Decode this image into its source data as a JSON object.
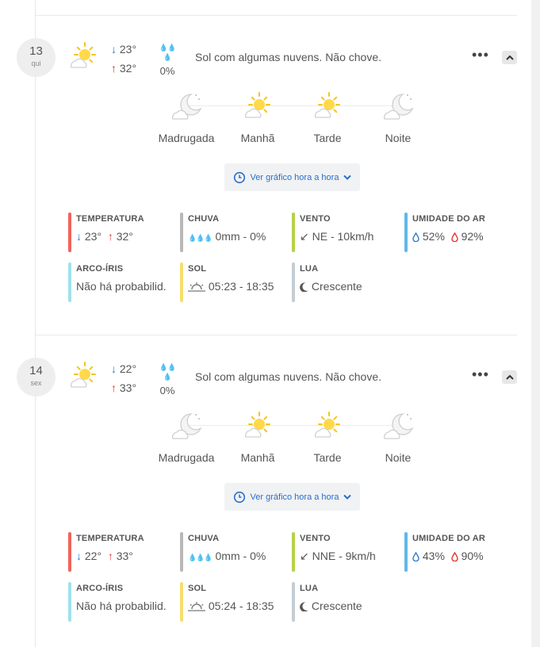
{
  "days": [
    {
      "day_number": "13",
      "weekday": "qui",
      "temp_min": "23°",
      "temp_max": "32°",
      "rain_prob": "0%",
      "description": "Sol com algumas nuvens. Não chove.",
      "periods": [
        {
          "label": "Madrugada",
          "icon": "moon-cloud-icon"
        },
        {
          "label": "Manhã",
          "icon": "sun-cloud-icon"
        },
        {
          "label": "Tarde",
          "icon": "sun-cloud-icon"
        },
        {
          "label": "Noite",
          "icon": "moon-cloud-icon"
        }
      ],
      "hourly_button": "Ver gráfico hora a hora",
      "stats": {
        "temperatura": {
          "title": "TEMPERATURA",
          "min": "23°",
          "max": "32°"
        },
        "chuva": {
          "title": "CHUVA",
          "value": "0mm - 0%"
        },
        "vento": {
          "title": "VENTO",
          "value": "NE - 10km/h"
        },
        "umidade": {
          "title": "UMIDADE DO AR",
          "min": "52%",
          "max": "92%"
        },
        "arco_iris": {
          "title": "ARCO-ÍRIS",
          "value": "Não há probabilid."
        },
        "sol": {
          "title": "SOL",
          "value": "05:23 - 18:35"
        },
        "lua": {
          "title": "LUA",
          "value": "Crescente"
        }
      }
    },
    {
      "day_number": "14",
      "weekday": "sex",
      "temp_min": "22°",
      "temp_max": "33°",
      "rain_prob": "0%",
      "description": "Sol com algumas nuvens. Não chove.",
      "periods": [
        {
          "label": "Madrugada",
          "icon": "moon-cloud-icon"
        },
        {
          "label": "Manhã",
          "icon": "sun-cloud-icon"
        },
        {
          "label": "Tarde",
          "icon": "sun-cloud-icon"
        },
        {
          "label": "Noite",
          "icon": "moon-cloud-icon"
        }
      ],
      "hourly_button": "Ver gráfico hora a hora",
      "stats": {
        "temperatura": {
          "title": "TEMPERATURA",
          "min": "22°",
          "max": "33°"
        },
        "chuva": {
          "title": "CHUVA",
          "value": "0mm - 0%"
        },
        "vento": {
          "title": "VENTO",
          "value": "NNE - 9km/h"
        },
        "umidade": {
          "title": "UMIDADE DO AR",
          "min": "43%",
          "max": "90%"
        },
        "arco_iris": {
          "title": "ARCO-ÍRIS",
          "value": "Não há probabilid."
        },
        "sol": {
          "title": "SOL",
          "value": "05:24 - 18:35"
        },
        "lua": {
          "title": "LUA",
          "value": "Crescente"
        }
      }
    }
  ],
  "colors": {
    "temperatura_bar": "#f0645a",
    "chuva_bar": "#b8b8b8",
    "vento_bar": "#b5d24a",
    "umidade_bar": "#5fb8ea",
    "arco_iris_bar": "#9ee3ea",
    "sol_bar": "#f7dd6b",
    "lua_bar": "#c4cdd3",
    "arrow_down": "#2a7bd5",
    "arrow_up": "#e2342e",
    "link": "#2a6fc9"
  }
}
